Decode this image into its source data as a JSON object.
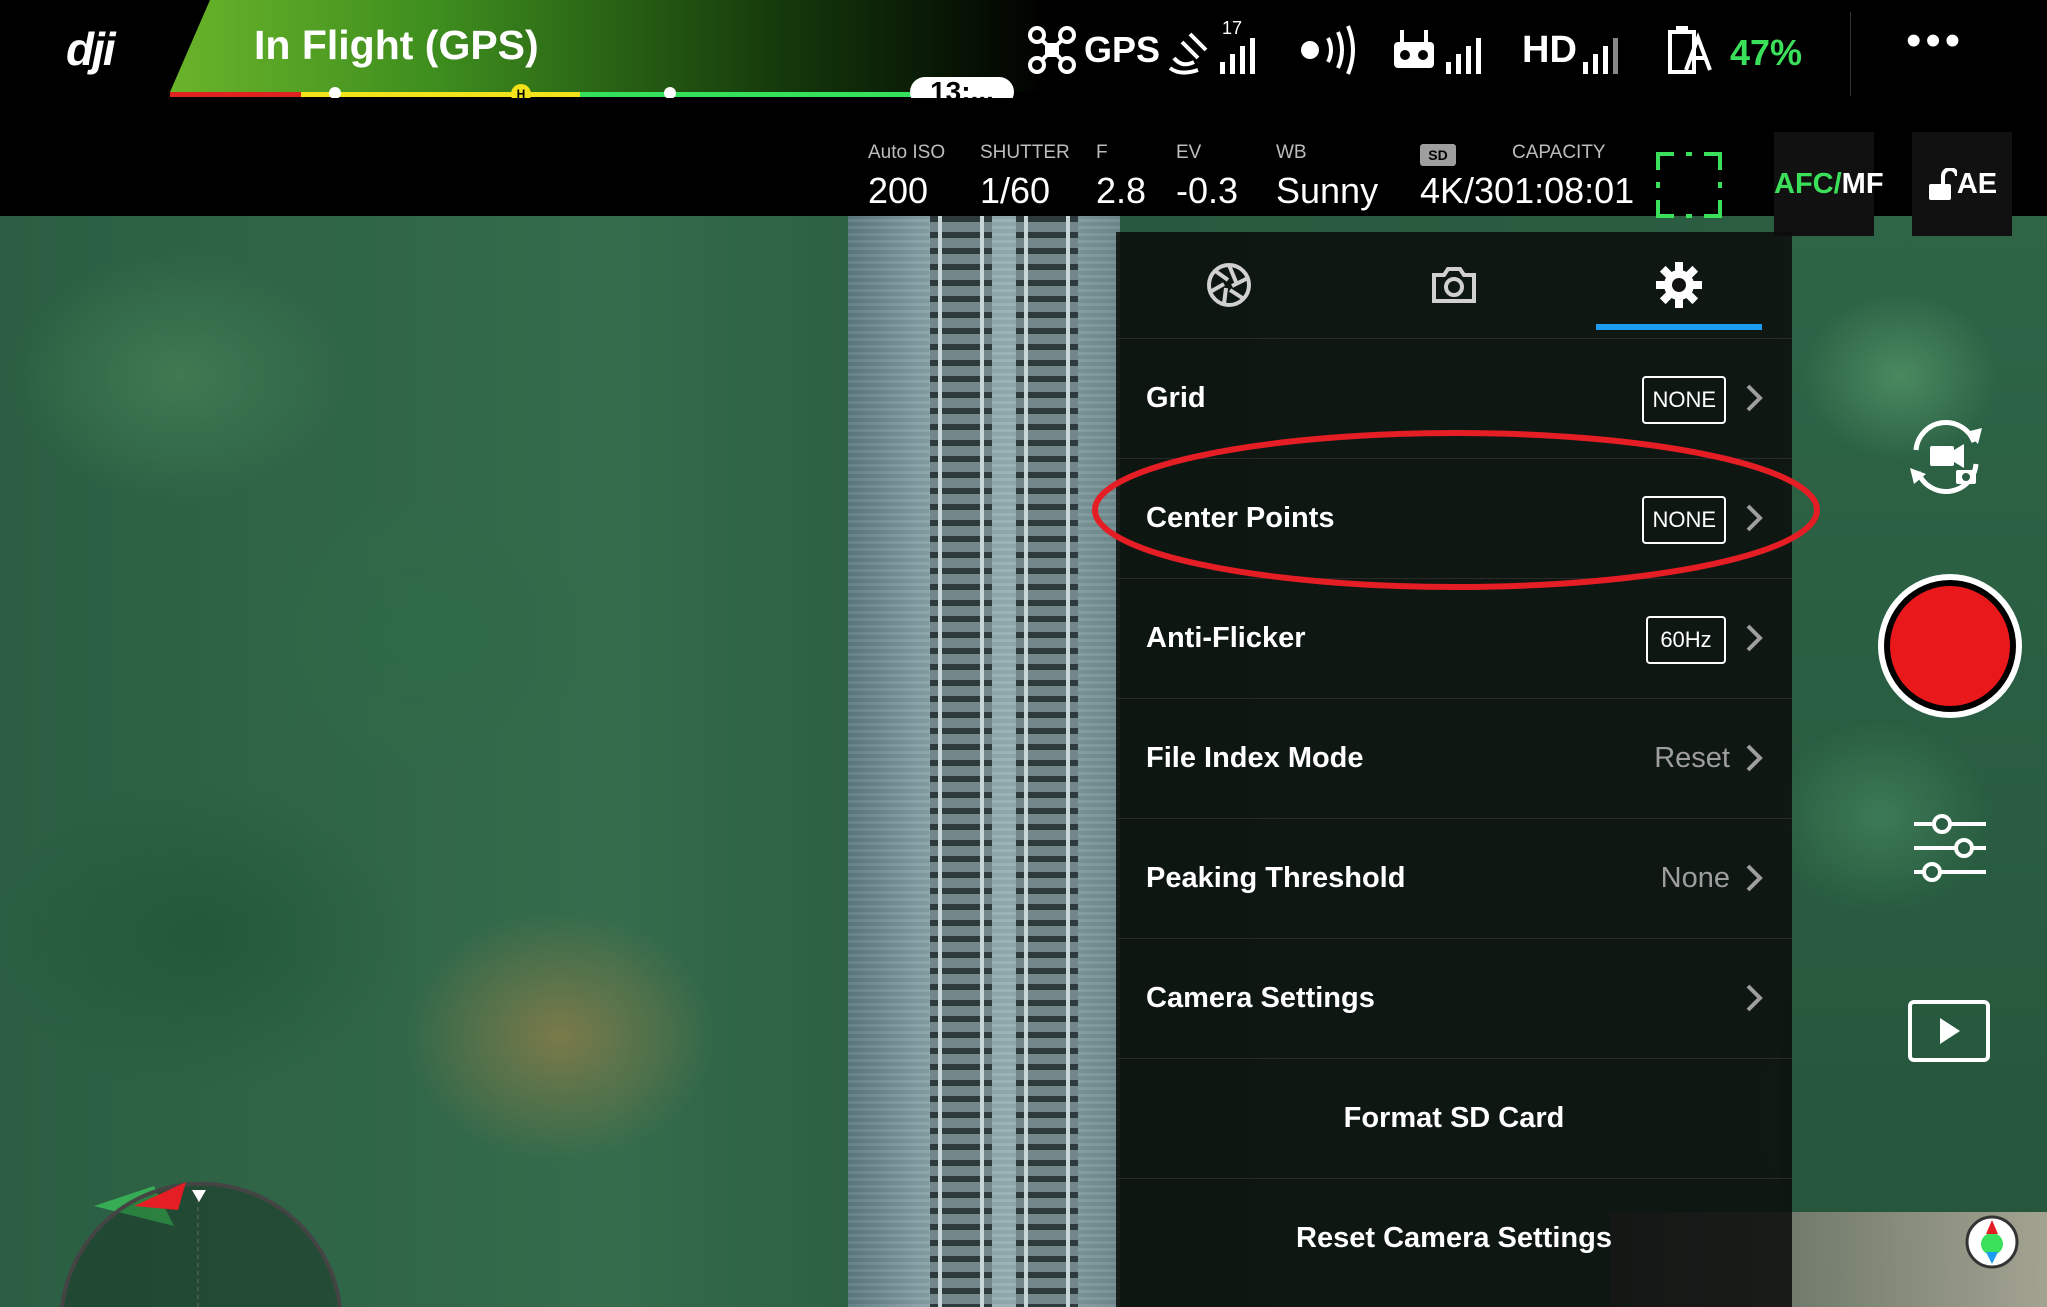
{
  "status_bar": {
    "brand": "dji",
    "flight_status": "In Flight (GPS)",
    "flight_time": "13:...",
    "home_marker": "H",
    "gps_label": "GPS",
    "satellite_count": "17",
    "video_link_label": "HD",
    "battery_percent": "47%",
    "more_label": "•••",
    "icons": [
      "aircraft-icon",
      "satellite-icon",
      "obstacle-sensing-icon",
      "remote-controller-icon",
      "battery-icon",
      "more-icon"
    ],
    "colors": {
      "battery_green": "#3be05a",
      "warning_yellow": "#f2e31a",
      "danger_red": "#e0231f"
    }
  },
  "camera_params": {
    "iso": {
      "label": "Auto ISO",
      "value": "200"
    },
    "shutter": {
      "label": "SHUTTER",
      "value": "1/60"
    },
    "aperture": {
      "label": "F",
      "value": "2.8"
    },
    "ev": {
      "label": "EV",
      "value": "-0.3"
    },
    "wb": {
      "label": "WB",
      "value": "Sunny"
    },
    "storage": {
      "sd_label": "SD",
      "label": "CAPACITY",
      "resolution": "4K/30",
      "remaining_time": "1:08:01"
    },
    "focus_mode": {
      "afc": "AFC/",
      "mf": "MF"
    },
    "ae_lock": {
      "label": "AE"
    }
  },
  "settings_panel": {
    "tabs": [
      {
        "icon": "aperture-icon",
        "active": false
      },
      {
        "icon": "camera-icon",
        "active": false
      },
      {
        "icon": "gear-icon",
        "active": true
      }
    ],
    "rows": [
      {
        "label": "Grid",
        "badge": "NONE"
      },
      {
        "label": "Center Points",
        "badge": "NONE",
        "highlighted": true
      },
      {
        "label": "Anti-Flicker",
        "badge": "60Hz"
      },
      {
        "label": "File Index Mode",
        "value": "Reset"
      },
      {
        "label": "Peaking Threshold",
        "value": "None"
      },
      {
        "label": "Camera Settings"
      },
      {
        "label": "Format SD Card"
      },
      {
        "label": "Reset Camera Settings"
      }
    ],
    "accent_color": "#1b9cf2",
    "highlight_color": "#e41e24"
  },
  "right_controls": {
    "icons": [
      "switch-photo-video-icon",
      "record-icon",
      "camera-settings-sliders-icon",
      "playback-icon"
    ],
    "record_color": "#e8181b"
  }
}
